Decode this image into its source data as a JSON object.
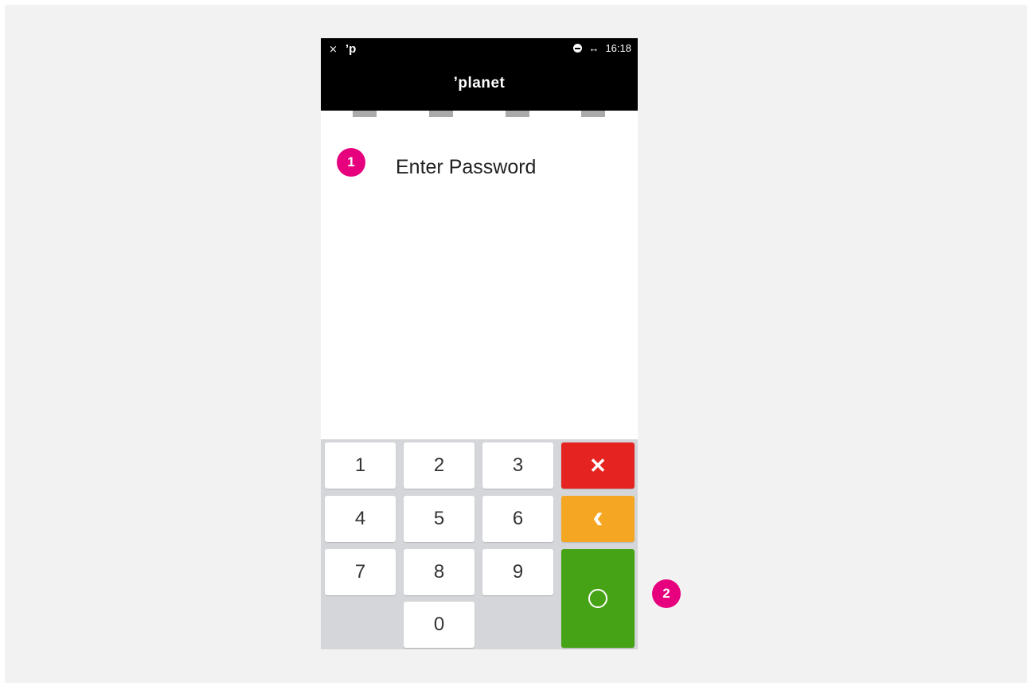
{
  "statusbar": {
    "left_icons": [
      "bluetooth-off-icon",
      "planet-p-icon"
    ],
    "left_glyphs": [
      "⨯",
      "’p"
    ],
    "dnd_icon": "do-not-disturb-icon",
    "data_glyph": "↔",
    "time": "16:18"
  },
  "header": {
    "logo": "’planet"
  },
  "screen": {
    "title": "Enter Password"
  },
  "keypad": {
    "digits": [
      "1",
      "2",
      "3",
      "4",
      "5",
      "6",
      "7",
      "8",
      "9",
      "0"
    ],
    "cancel_glyph": "✕",
    "back_glyph": "‹",
    "colors": {
      "cancel": "#e52421",
      "back": "#f5a623",
      "ok": "#46a315"
    }
  },
  "annotations": [
    "1",
    "2"
  ]
}
